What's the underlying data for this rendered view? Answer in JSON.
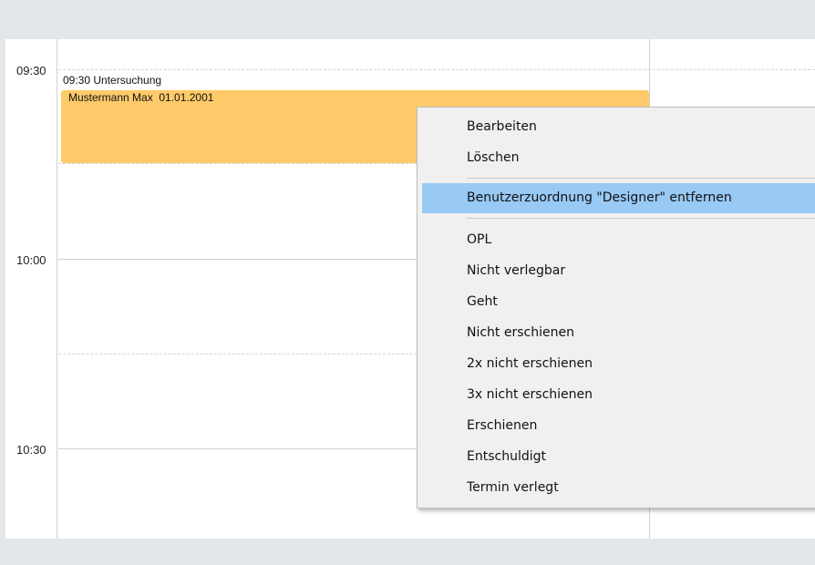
{
  "calendar": {
    "time_labels": [
      "09:30",
      "10:00",
      "10:30"
    ],
    "appointment": {
      "header": "09:30 Untersuchung",
      "title": "Mustermann Max  01.01.2001",
      "color": "#ffca6a"
    }
  },
  "context_menu": {
    "group1": [
      "Bearbeiten",
      "Löschen"
    ],
    "highlighted": "Benutzerzuordnung \"Designer\" entfernen",
    "group2": [
      "OPL",
      "Nicht verlegbar",
      "Geht",
      "Nicht erschienen",
      "2x nicht erschienen",
      "3x nicht erschienen",
      "Erschienen",
      "Entschuldigt",
      "Termin verlegt"
    ],
    "highlight_color": "#99c9f5"
  }
}
